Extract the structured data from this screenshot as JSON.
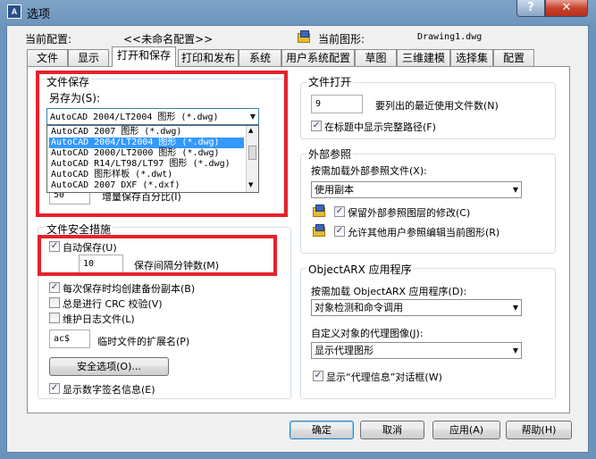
{
  "window": {
    "title": "选项",
    "help_glyph": "?",
    "close_glyph": "✕",
    "app_icon_text": "A"
  },
  "header": {
    "current_profile_label": "当前配置:",
    "current_profile_value": "<<未命名配置>>",
    "current_drawing_label": "当前图形:",
    "current_drawing_value": "Drawing1.dwg"
  },
  "tabs": [
    {
      "label": "文件"
    },
    {
      "label": "显示"
    },
    {
      "label": "打开和保存"
    },
    {
      "label": "打印和发布"
    },
    {
      "label": "系统"
    },
    {
      "label": "用户系统配置"
    },
    {
      "label": "草图"
    },
    {
      "label": "三维建模"
    },
    {
      "label": "选择集"
    },
    {
      "label": "配置"
    }
  ],
  "active_tab": "打开和保存",
  "file_save": {
    "title": "文件保存",
    "save_as_label": "另存为(S):",
    "save_as_value": "AutoCAD 2004/LT2004 图形 (*.dwg)",
    "dropdown_options": [
      "AutoCAD 2007 图形 (*.dwg)",
      "AutoCAD 2004/LT2004 图形 (*.dwg)",
      "AutoCAD 2000/LT2000 图形 (*.dwg)",
      "AutoCAD R14/LT98/LT97 图形 (*.dwg)",
      "AutoCAD 图形样板 (*.dwt)",
      "AutoCAD 2007 DXF (*.dxf)"
    ],
    "selected_option_index": 1,
    "incremental_value": "50",
    "incremental_label": "增量保存百分比(I)"
  },
  "file_safety": {
    "title": "文件安全措施",
    "autosave_label": "自动保存(U)",
    "autosave_checked": true,
    "autosave_minutes": "10",
    "autosave_minutes_label": "保存间隔分钟数(M)",
    "backup_label": "每次保存时均创建备份副本(B)",
    "backup_checked": true,
    "crc_label": "总是进行 CRC 校验(V)",
    "crc_checked": false,
    "log_label": "维护日志文件(L)",
    "log_checked": false,
    "temp_ext_value": "ac$",
    "temp_ext_label": "临时文件的扩展名(P)",
    "security_button": "安全选项(O)...",
    "digital_sig_label": "显示数字签名信息(E)",
    "digital_sig_checked": true
  },
  "file_open": {
    "title": "文件打开",
    "recent_count": "9",
    "recent_label": "要列出的最近使用文件数(N)",
    "full_path_label": "在标题中显示完整路径(F)",
    "full_path_checked": true
  },
  "xref": {
    "title": "外部参照",
    "demand_load_label": "按需加载外部参照文件(X):",
    "demand_load_value": "使用副本",
    "retain_label": "保留外部参照图层的修改(C)",
    "retain_checked": true,
    "allow_edit_label": "允许其他用户参照编辑当前图形(R)",
    "allow_edit_checked": true
  },
  "objectarx": {
    "title": "ObjectARX 应用程序",
    "demand_load_label": "按需加载 ObjectARX 应用程序(D):",
    "demand_load_value": "对象检测和命令调用",
    "proxy_images_label": "自定义对象的代理图像(J):",
    "proxy_images_value": "显示代理图形",
    "proxy_info_label": "显示“代理信息”对话框(W)",
    "proxy_info_checked": true
  },
  "buttons": {
    "ok": "确定",
    "cancel": "取消",
    "apply": "应用(A)",
    "help": "帮助(H)"
  },
  "icons": {
    "check": "✓",
    "dropdown_arrow": "▼",
    "scroll_up": "▲",
    "scroll_down": "▼"
  },
  "colors": {
    "highlight": "#e5222b",
    "selection": "#3399ff"
  }
}
